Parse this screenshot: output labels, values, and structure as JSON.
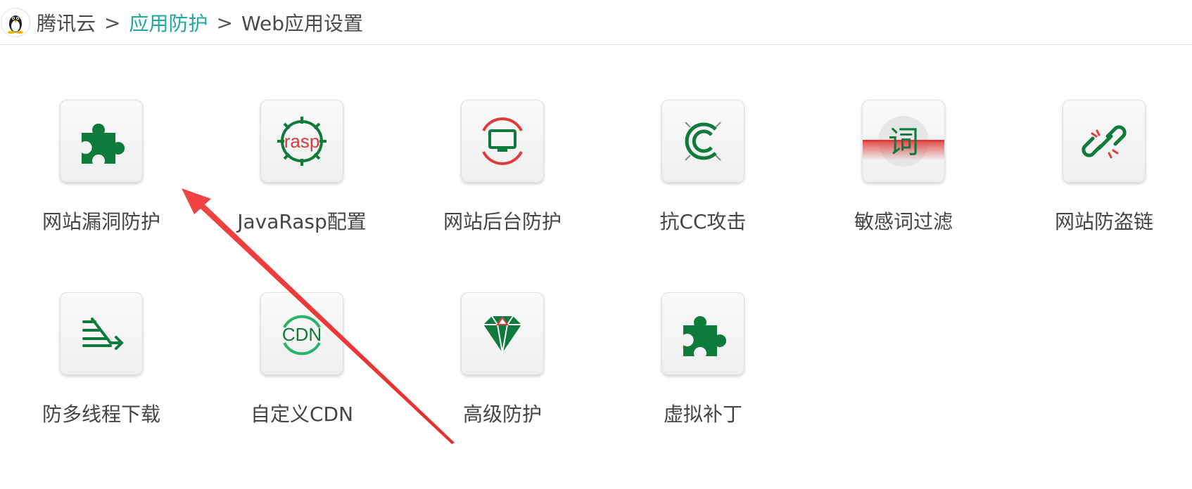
{
  "breadcrumb": {
    "root": "腾讯云",
    "separator": ">",
    "section": "应用防护",
    "current": "Web应用设置"
  },
  "colors": {
    "brand_green": "#0e7a3c",
    "accent_red": "#e03b3b",
    "link_teal": "#20a8a0"
  },
  "tiles": [
    {
      "label": "网站漏洞防护",
      "icon": "puzzle-icon"
    },
    {
      "label": "JavaRasp配置",
      "icon": "rasp-gear-icon"
    },
    {
      "label": "网站后台防护",
      "icon": "monitor-shield-icon"
    },
    {
      "label": "抗CC攻击",
      "icon": "cc-icon"
    },
    {
      "label": "敏感词过滤",
      "icon": "word-filter-icon"
    },
    {
      "label": "网站防盗链",
      "icon": "broken-link-icon"
    },
    {
      "label": "防多线程下载",
      "icon": "multi-thread-icon"
    },
    {
      "label": "自定义CDN",
      "icon": "cdn-icon"
    },
    {
      "label": "高级防护",
      "icon": "diamond-icon"
    },
    {
      "label": "虚拟补丁",
      "icon": "patch-puzzle-icon"
    }
  ],
  "annotation": {
    "icon": "red-arrow-icon",
    "points_to": "网站漏洞防护"
  },
  "rasp_icon_text": "rasp",
  "cdn_icon_text": "CDN",
  "word_icon_text": "词"
}
